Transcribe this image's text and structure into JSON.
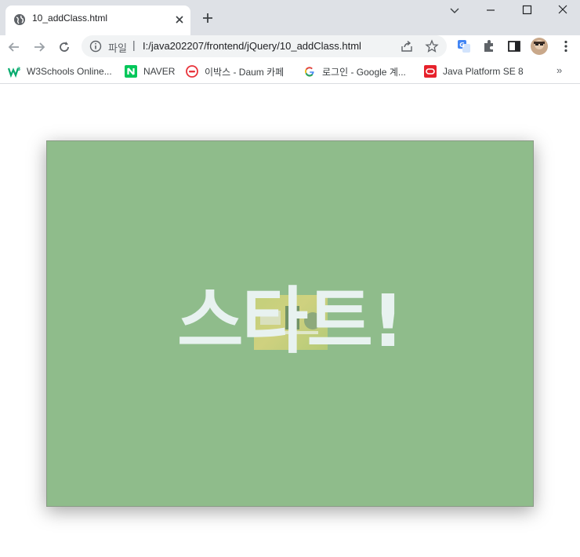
{
  "browser": {
    "tab": {
      "title": "10_addClass.html"
    },
    "omnibox": {
      "scheme_label": "파일",
      "separator": "|",
      "url": "I:/java202207/frontend/jQuery/10_addClass.html"
    },
    "bookmarks": [
      {
        "label": "W3Schools Online...",
        "icon": "w3schools-icon"
      },
      {
        "label": "NAVER",
        "icon": "naver-icon"
      },
      {
        "label": "이박스 - Daum 카페",
        "icon": "daum-cafe-icon"
      },
      {
        "label": "로그인 - Google 계...",
        "icon": "google-icon"
      },
      {
        "label": "Java Platform SE 8",
        "icon": "oracle-icon"
      }
    ],
    "bookmarks_overflow": "»"
  },
  "page": {
    "stage": {
      "background": "#8fbc8b",
      "text": "스타트!",
      "text_color": "#e8f2f0"
    }
  }
}
